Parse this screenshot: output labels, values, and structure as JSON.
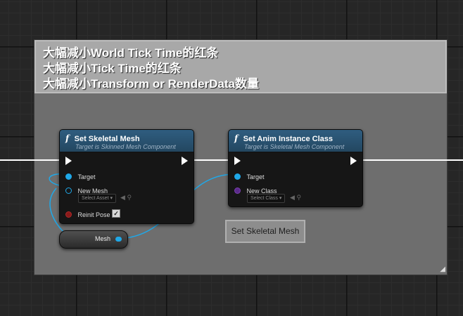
{
  "comment": {
    "lines": [
      "大幅减小World Tick Time的红条",
      "大幅减小Tick Time的红条",
      "大幅减小Transform or RenderData数量"
    ]
  },
  "nodes": {
    "set_skeletal_mesh": {
      "title": "Set Skeletal Mesh",
      "subtitle": "Target is Skinned Mesh Component",
      "pins": {
        "target": "Target",
        "new_mesh": "New Mesh",
        "select_asset": "Select Asset",
        "reinit_pose": "Reinit Pose"
      },
      "reinit_pose_checked": true
    },
    "set_anim_instance_class": {
      "title": "Set Anim Instance Class",
      "subtitle": "Target is Skeletal Mesh Component",
      "pins": {
        "target": "Target",
        "new_class": "New Class",
        "select_class": "Select Class"
      }
    },
    "mesh_variable": {
      "label": "Mesh"
    }
  },
  "button": {
    "label": "Set Skeletal Mesh"
  },
  "colors": {
    "object_pin": "#1fa8e8",
    "class_pin": "#5a2a8a",
    "bool_pin": "#8a1a1a",
    "exec_wire": "#ffffff",
    "node_header": "#2f5d80"
  },
  "icons": {
    "function": "function-icon",
    "checkbox": "checkmark-icon",
    "dropdown": "chevron-down-icon",
    "use": "arrow-left-icon",
    "browse": "search-icon"
  }
}
